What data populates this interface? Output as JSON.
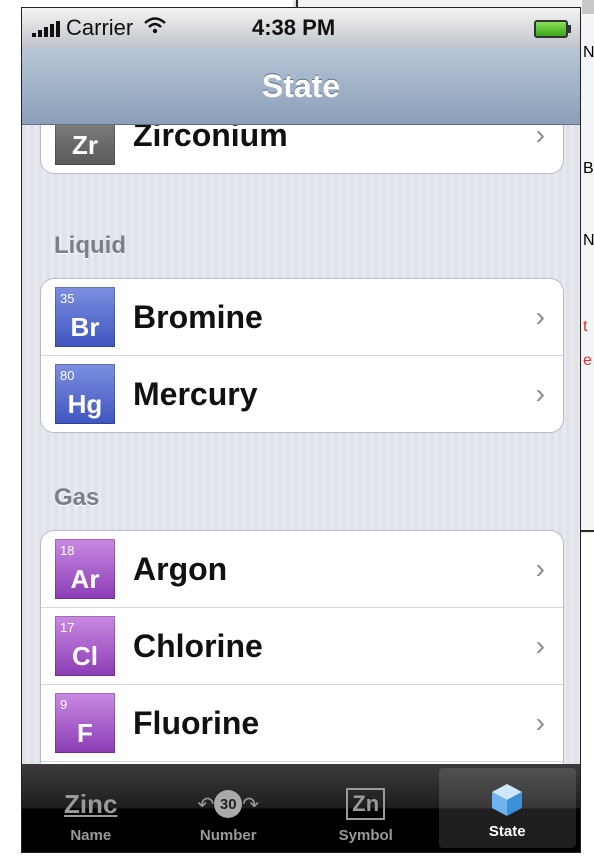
{
  "status_bar": {
    "carrier": "Carrier",
    "time": "4:38 PM"
  },
  "nav": {
    "title": "State"
  },
  "sections": {
    "solid_tail": {
      "symbol": "Zr",
      "name": "Zirconium"
    },
    "liquid": {
      "header": "Liquid",
      "items": [
        {
          "number": "35",
          "symbol": "Br",
          "name": "Bromine"
        },
        {
          "number": "80",
          "symbol": "Hg",
          "name": "Mercury"
        }
      ]
    },
    "gas": {
      "header": "Gas",
      "items": [
        {
          "number": "18",
          "symbol": "Ar",
          "name": "Argon"
        },
        {
          "number": "17",
          "symbol": "Cl",
          "name": "Chlorine"
        },
        {
          "number": "9",
          "symbol": "F",
          "name": "Fluorine"
        }
      ]
    }
  },
  "tabs": [
    {
      "label": "Name",
      "icon": "Zinc"
    },
    {
      "label": "Number",
      "icon": "30"
    },
    {
      "label": "Symbol",
      "icon": "Zn"
    },
    {
      "label": "State",
      "icon": "cube-icon"
    }
  ],
  "background_window": {
    "letters": [
      "N",
      "B",
      "N",
      "t",
      "e"
    ]
  },
  "colors": {
    "liquid": "#4a5fc8",
    "gas": "#9a48c0",
    "solid": "#6b6b6b",
    "nav": "#9aabc2"
  }
}
